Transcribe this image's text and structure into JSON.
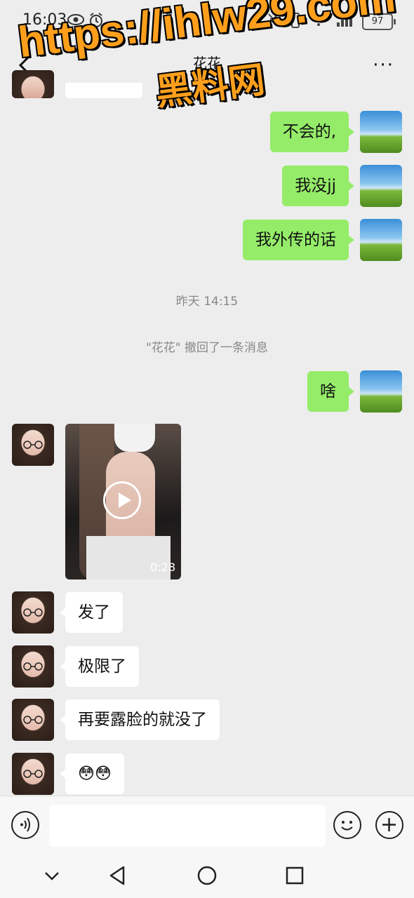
{
  "status_bar": {
    "time": "16:03",
    "battery": "97",
    "icons": [
      "eye-icon",
      "alarm-icon",
      "mute-icon",
      "vibrate-icon",
      "wifi-icon",
      "signal-icon"
    ]
  },
  "header": {
    "title": "花花",
    "back_icon": "chevron-left-icon",
    "more_label": "···"
  },
  "watermark": {
    "line1": "https://ihlw29.com",
    "line2": "黑料网",
    "color": "#ff9f1c"
  },
  "messages": [
    {
      "from": "me",
      "type": "text",
      "text": "不会的,"
    },
    {
      "from": "me",
      "type": "text",
      "text": "我没jj"
    },
    {
      "from": "me",
      "type": "text",
      "text": "我外传的话"
    },
    {
      "type": "time",
      "text": "昨天 14:15"
    },
    {
      "type": "system",
      "text": "\"花花\" 撤回了一条消息"
    },
    {
      "from": "me",
      "type": "text",
      "text": "啥"
    },
    {
      "from": "her",
      "type": "video",
      "duration": "0:28"
    },
    {
      "from": "her",
      "type": "text",
      "text": "发了"
    },
    {
      "from": "her",
      "type": "text",
      "text": "极限了"
    },
    {
      "from": "her",
      "type": "text",
      "text": "再要露脸的就没了"
    },
    {
      "from": "her",
      "type": "text",
      "text": "😳😳"
    }
  ],
  "input_bar": {
    "voice_icon": "voice-icon",
    "placeholder": "",
    "emoji_icon": "emoji-icon",
    "plus_icon": "plus-icon"
  },
  "nav_bar": {
    "icons": [
      "chevron-down-icon",
      "back-triangle-icon",
      "home-circle-icon",
      "recents-square-icon"
    ]
  },
  "colors": {
    "background": "#ededed",
    "my_bubble": "#95ec69",
    "her_bubble": "#ffffff"
  }
}
